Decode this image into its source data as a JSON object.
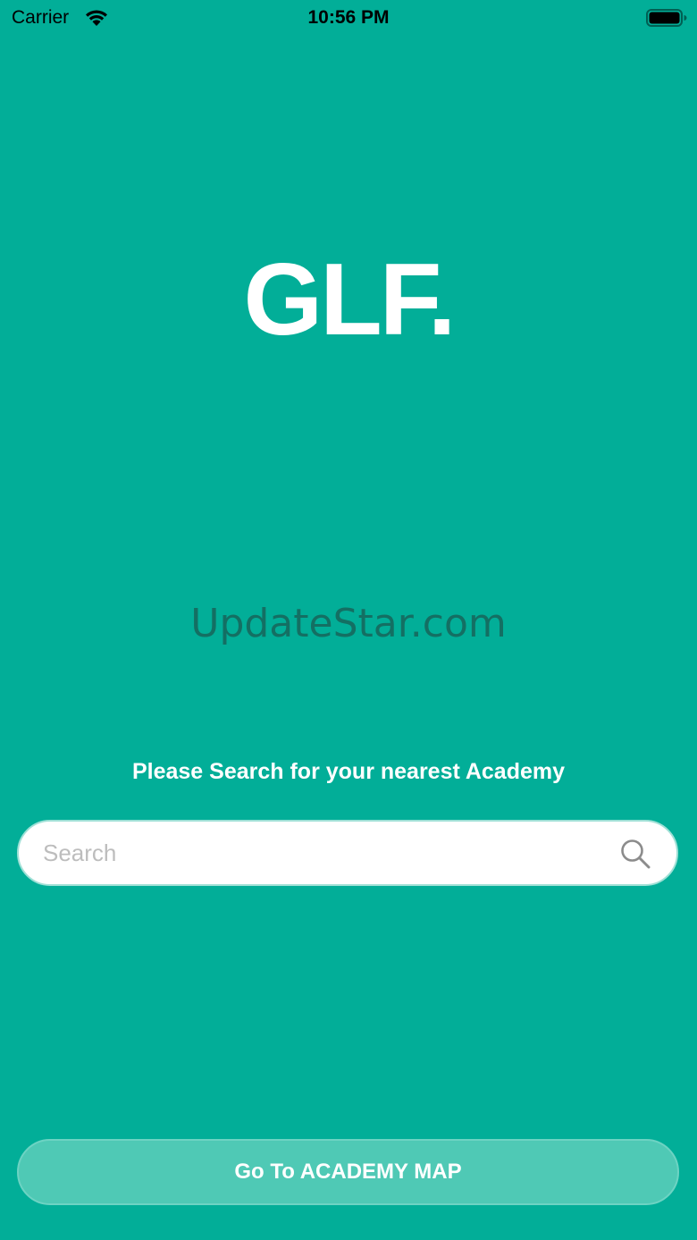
{
  "status_bar": {
    "carrier": "Carrier",
    "time": "10:56 PM",
    "wifi_icon": "wifi-icon",
    "battery_icon": "battery-full-icon"
  },
  "logo": {
    "text": "GLF."
  },
  "watermark": {
    "text": "UpdateStar.com"
  },
  "prompt": {
    "text": "Please Search for your nearest Academy"
  },
  "search": {
    "value": "",
    "placeholder": "Search",
    "icon": "search-icon"
  },
  "map_button": {
    "label": "Go To ACADEMY MAP"
  },
  "colors": {
    "background": "#02AE98",
    "button": "#4FC9B5",
    "text": "#FFFFFF"
  }
}
